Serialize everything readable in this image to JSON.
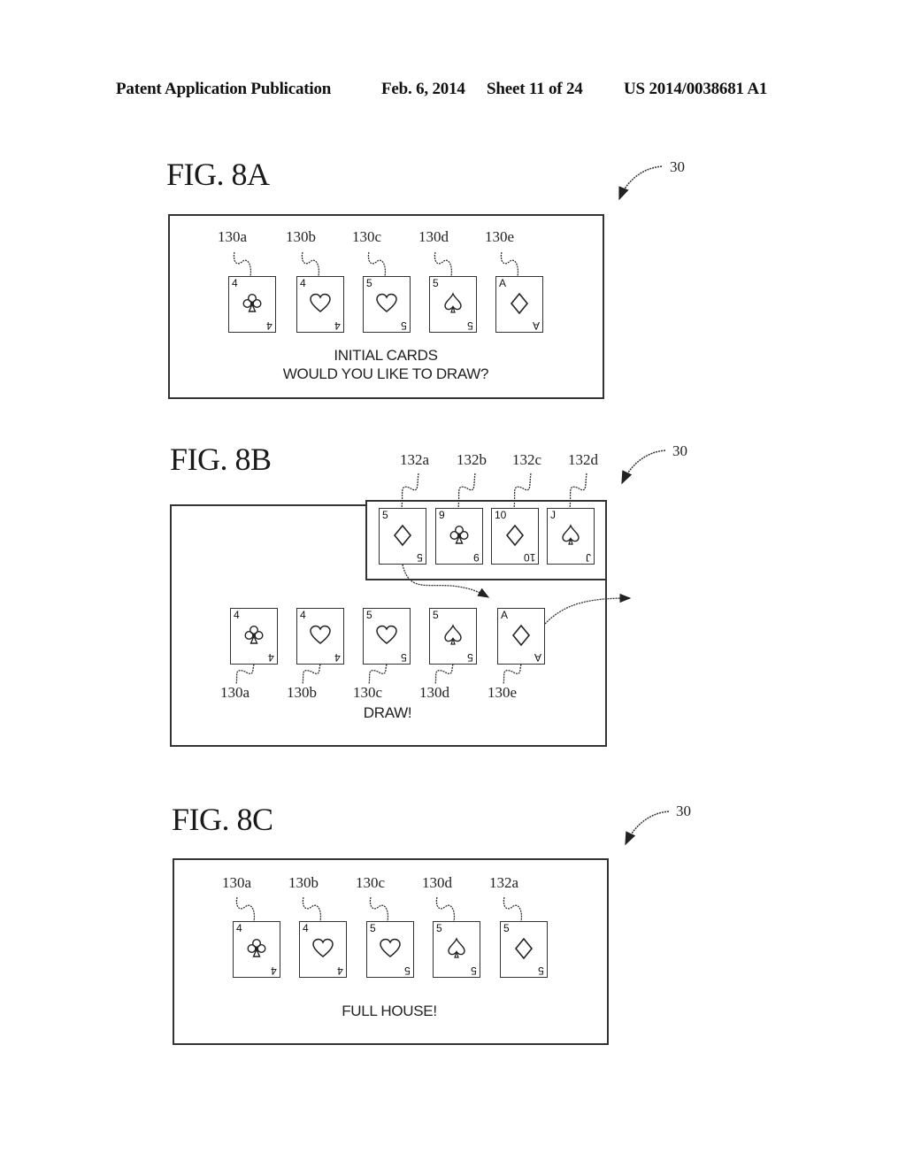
{
  "header": {
    "publication": "Patent Application Publication",
    "date": "Feb. 6, 2014",
    "sheet": "Sheet 11 of 24",
    "number": "US 2014/0038681 A1"
  },
  "figures": [
    {
      "title": "FIG. 8A",
      "ref": "30",
      "caption_lines": [
        "INITIAL CARDS",
        "WOULD YOU LIKE TO DRAW?"
      ],
      "cards": [
        {
          "label": "130a",
          "rank": "4",
          "suit": "club"
        },
        {
          "label": "130b",
          "rank": "4",
          "suit": "heart"
        },
        {
          "label": "130c",
          "rank": "5",
          "suit": "heart"
        },
        {
          "label": "130d",
          "rank": "5",
          "suit": "spade"
        },
        {
          "label": "130e",
          "rank": "A",
          "suit": "diamond"
        }
      ]
    },
    {
      "title": "FIG. 8B",
      "ref": "30",
      "caption_lines": [
        "DRAW!"
      ],
      "draw_cards": [
        {
          "label": "132a",
          "rank": "5",
          "suit": "diamond"
        },
        {
          "label": "132b",
          "rank": "9",
          "suit": "club"
        },
        {
          "label": "132c",
          "rank": "10",
          "suit": "diamond"
        },
        {
          "label": "132d",
          "rank": "J",
          "suit": "spade"
        }
      ],
      "cards": [
        {
          "label": "130a",
          "rank": "4",
          "suit": "club"
        },
        {
          "label": "130b",
          "rank": "4",
          "suit": "heart"
        },
        {
          "label": "130c",
          "rank": "5",
          "suit": "heart"
        },
        {
          "label": "130d",
          "rank": "5",
          "suit": "spade"
        },
        {
          "label": "130e",
          "rank": "A",
          "suit": "diamond"
        }
      ]
    },
    {
      "title": "FIG. 8C",
      "ref": "30",
      "caption_lines": [
        "FULL HOUSE!"
      ],
      "cards": [
        {
          "label": "130a",
          "rank": "4",
          "suit": "club"
        },
        {
          "label": "130b",
          "rank": "4",
          "suit": "heart"
        },
        {
          "label": "130c",
          "rank": "5",
          "suit": "heart"
        },
        {
          "label": "130d",
          "rank": "5",
          "suit": "spade"
        },
        {
          "label": "132a",
          "rank": "5",
          "suit": "diamond"
        }
      ]
    }
  ]
}
